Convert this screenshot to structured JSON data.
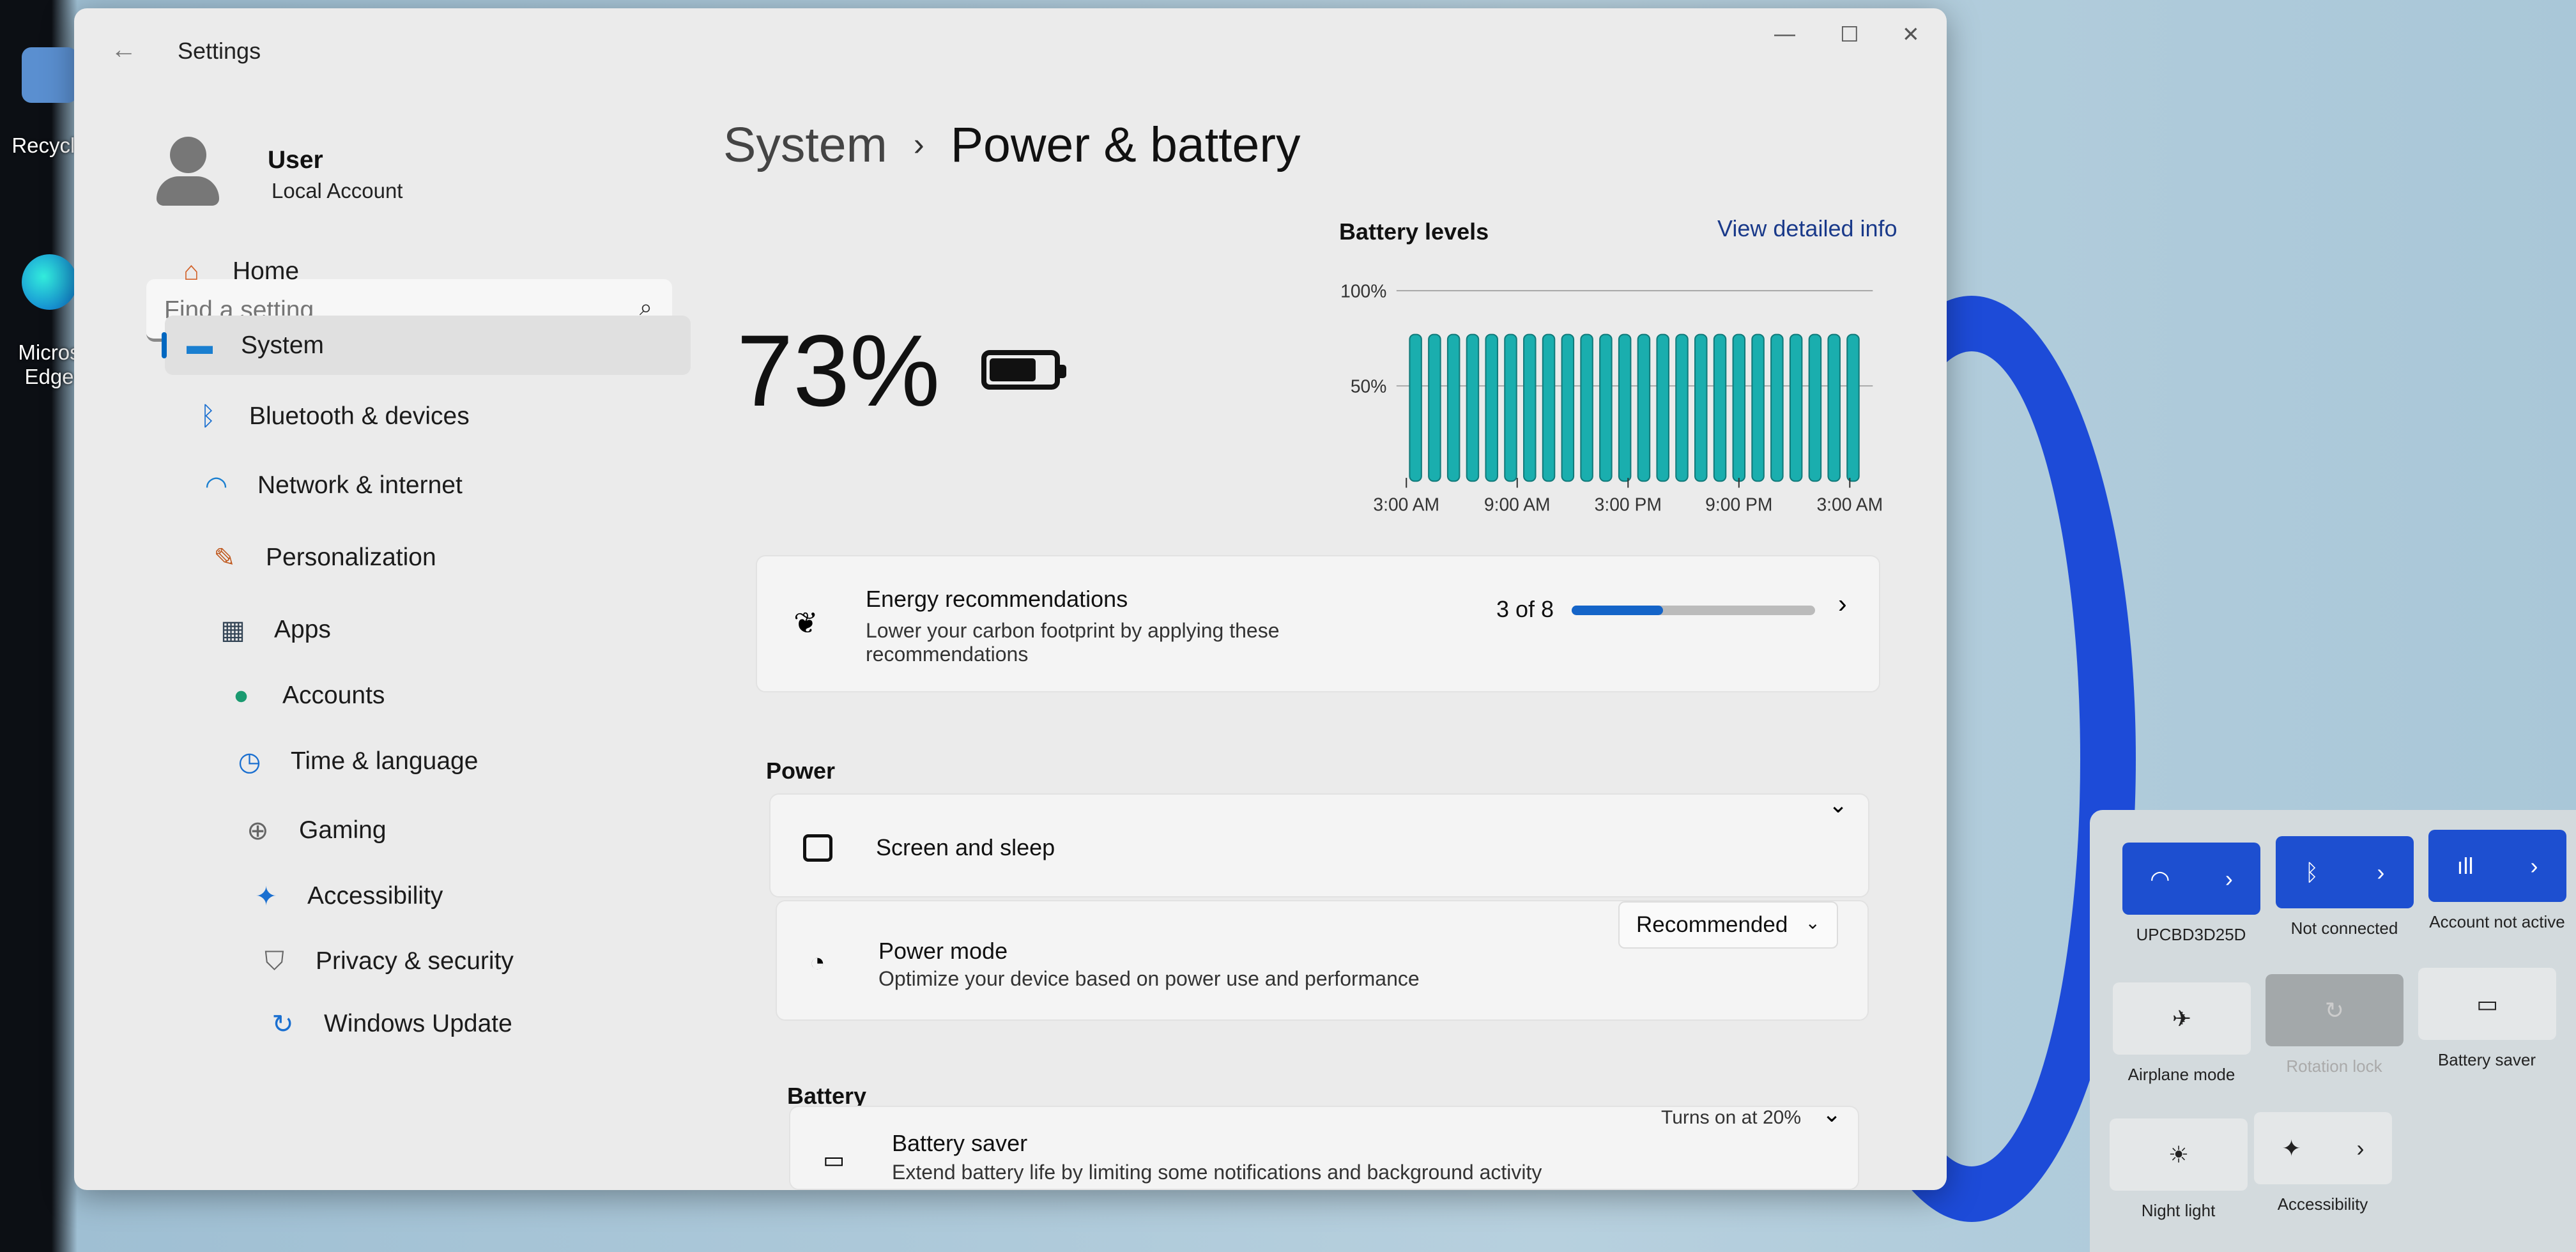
{
  "desktop": {
    "icons": [
      {
        "label": "Recycle"
      },
      {
        "label": "Micros\nEdge"
      }
    ]
  },
  "window": {
    "title": "Settings",
    "minimize": "—",
    "maximize": "☐",
    "close": "✕",
    "back": "←"
  },
  "user": {
    "name": "User",
    "account_type": "Local Account"
  },
  "search": {
    "placeholder": "Find a setting",
    "icon": "search-icon"
  },
  "sidebar": {
    "items": [
      {
        "label": "Home",
        "icon": "home-icon",
        "active": false
      },
      {
        "label": "System",
        "icon": "system-icon",
        "active": true
      },
      {
        "label": "Bluetooth & devices",
        "icon": "bluetooth-icon",
        "active": false
      },
      {
        "label": "Network & internet",
        "icon": "wifi-icon",
        "active": false
      },
      {
        "label": "Personalization",
        "icon": "brush-icon",
        "active": false
      },
      {
        "label": "Apps",
        "icon": "apps-icon",
        "active": false
      },
      {
        "label": "Accounts",
        "icon": "accounts-icon",
        "active": false
      },
      {
        "label": "Time & language",
        "icon": "clock-globe-icon",
        "active": false
      },
      {
        "label": "Gaming",
        "icon": "gamepad-icon",
        "active": false
      },
      {
        "label": "Accessibility",
        "icon": "accessibility-icon",
        "active": false
      },
      {
        "label": "Privacy & security",
        "icon": "shield-icon",
        "active": false
      },
      {
        "label": "Windows Update",
        "icon": "update-icon",
        "active": false
      }
    ]
  },
  "breadcrumb": {
    "parent": "System",
    "separator": "›",
    "current": "Power & battery"
  },
  "battery": {
    "percent_label": "73%",
    "level": 73
  },
  "battery_chart": {
    "title": "Battery levels",
    "link": "View detailed info"
  },
  "chart_data": {
    "type": "bar",
    "title": "Battery levels",
    "yticks": [
      "100%",
      "50%"
    ],
    "ylim": [
      0,
      100
    ],
    "xticks": [
      "3:00 AM",
      "9:00 AM",
      "3:00 PM",
      "9:00 PM",
      "3:00 AM"
    ],
    "values": [
      77,
      77,
      77,
      77,
      77,
      77,
      77,
      77,
      77,
      77,
      77,
      77,
      77,
      77,
      77,
      77,
      77,
      77,
      77,
      77,
      77,
      77,
      77,
      77
    ],
    "bar_color": "#1aaeae",
    "grid": true
  },
  "energy": {
    "title": "Energy recommendations",
    "description": "Lower your carbon footprint by applying these recommendations",
    "progress_label": "3 of 8",
    "progress": 0.375
  },
  "power": {
    "section": "Power",
    "screen_sleep": "Screen and sleep",
    "power_mode": {
      "title": "Power mode",
      "description": "Optimize your device based on power use and performance",
      "value": "Recommended"
    }
  },
  "battery_section": {
    "section": "Battery",
    "saver": {
      "title": "Battery saver",
      "description": "Extend battery life by limiting some notifications and background activity",
      "status": "Turns on at 20%"
    }
  },
  "quick_settings": {
    "accent": "#1d4fd0",
    "tiles": [
      {
        "label": "UPCBD3D25D",
        "icon": "wifi-icon",
        "state": "on"
      },
      {
        "label": "Not connected",
        "icon": "bluetooth-icon",
        "state": "on"
      },
      {
        "label": "Account not active",
        "icon": "cellular-icon",
        "state": "on"
      },
      {
        "label": "Airplane mode",
        "icon": "airplane-icon",
        "state": "off"
      },
      {
        "label": "Rotation lock",
        "icon": "rotation-lock-icon",
        "state": "disabled"
      },
      {
        "label": "Battery saver",
        "icon": "battery-saver-icon",
        "state": "off"
      },
      {
        "label": "Night light",
        "icon": "night-light-icon",
        "state": "off"
      },
      {
        "label": "Accessibility",
        "icon": "accessibility-icon",
        "state": "off"
      }
    ]
  }
}
